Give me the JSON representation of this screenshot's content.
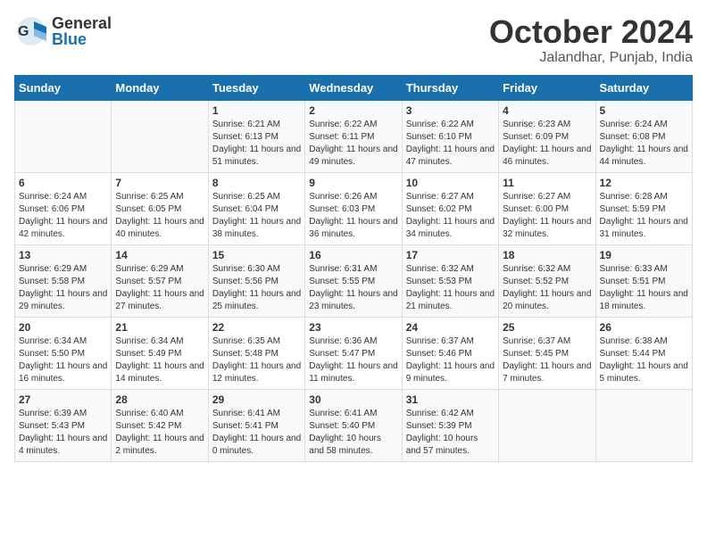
{
  "header": {
    "logo_line1": "General",
    "logo_line2": "Blue",
    "month_title": "October 2024",
    "location": "Jalandhar, Punjab, India"
  },
  "weekdays": [
    "Sunday",
    "Monday",
    "Tuesday",
    "Wednesday",
    "Thursday",
    "Friday",
    "Saturday"
  ],
  "weeks": [
    [
      null,
      null,
      {
        "day": 1,
        "sunrise": "6:21 AM",
        "sunset": "6:13 PM",
        "daylight": "11 hours and 51 minutes."
      },
      {
        "day": 2,
        "sunrise": "6:22 AM",
        "sunset": "6:11 PM",
        "daylight": "11 hours and 49 minutes."
      },
      {
        "day": 3,
        "sunrise": "6:22 AM",
        "sunset": "6:10 PM",
        "daylight": "11 hours and 47 minutes."
      },
      {
        "day": 4,
        "sunrise": "6:23 AM",
        "sunset": "6:09 PM",
        "daylight": "11 hours and 46 minutes."
      },
      {
        "day": 5,
        "sunrise": "6:24 AM",
        "sunset": "6:08 PM",
        "daylight": "11 hours and 44 minutes."
      }
    ],
    [
      {
        "day": 6,
        "sunrise": "6:24 AM",
        "sunset": "6:06 PM",
        "daylight": "11 hours and 42 minutes."
      },
      {
        "day": 7,
        "sunrise": "6:25 AM",
        "sunset": "6:05 PM",
        "daylight": "11 hours and 40 minutes."
      },
      {
        "day": 8,
        "sunrise": "6:25 AM",
        "sunset": "6:04 PM",
        "daylight": "11 hours and 38 minutes."
      },
      {
        "day": 9,
        "sunrise": "6:26 AM",
        "sunset": "6:03 PM",
        "daylight": "11 hours and 36 minutes."
      },
      {
        "day": 10,
        "sunrise": "6:27 AM",
        "sunset": "6:02 PM",
        "daylight": "11 hours and 34 minutes."
      },
      {
        "day": 11,
        "sunrise": "6:27 AM",
        "sunset": "6:00 PM",
        "daylight": "11 hours and 32 minutes."
      },
      {
        "day": 12,
        "sunrise": "6:28 AM",
        "sunset": "5:59 PM",
        "daylight": "11 hours and 31 minutes."
      }
    ],
    [
      {
        "day": 13,
        "sunrise": "6:29 AM",
        "sunset": "5:58 PM",
        "daylight": "11 hours and 29 minutes."
      },
      {
        "day": 14,
        "sunrise": "6:29 AM",
        "sunset": "5:57 PM",
        "daylight": "11 hours and 27 minutes."
      },
      {
        "day": 15,
        "sunrise": "6:30 AM",
        "sunset": "5:56 PM",
        "daylight": "11 hours and 25 minutes."
      },
      {
        "day": 16,
        "sunrise": "6:31 AM",
        "sunset": "5:55 PM",
        "daylight": "11 hours and 23 minutes."
      },
      {
        "day": 17,
        "sunrise": "6:32 AM",
        "sunset": "5:53 PM",
        "daylight": "11 hours and 21 minutes."
      },
      {
        "day": 18,
        "sunrise": "6:32 AM",
        "sunset": "5:52 PM",
        "daylight": "11 hours and 20 minutes."
      },
      {
        "day": 19,
        "sunrise": "6:33 AM",
        "sunset": "5:51 PM",
        "daylight": "11 hours and 18 minutes."
      }
    ],
    [
      {
        "day": 20,
        "sunrise": "6:34 AM",
        "sunset": "5:50 PM",
        "daylight": "11 hours and 16 minutes."
      },
      {
        "day": 21,
        "sunrise": "6:34 AM",
        "sunset": "5:49 PM",
        "daylight": "11 hours and 14 minutes."
      },
      {
        "day": 22,
        "sunrise": "6:35 AM",
        "sunset": "5:48 PM",
        "daylight": "11 hours and 12 minutes."
      },
      {
        "day": 23,
        "sunrise": "6:36 AM",
        "sunset": "5:47 PM",
        "daylight": "11 hours and 11 minutes."
      },
      {
        "day": 24,
        "sunrise": "6:37 AM",
        "sunset": "5:46 PM",
        "daylight": "11 hours and 9 minutes."
      },
      {
        "day": 25,
        "sunrise": "6:37 AM",
        "sunset": "5:45 PM",
        "daylight": "11 hours and 7 minutes."
      },
      {
        "day": 26,
        "sunrise": "6:38 AM",
        "sunset": "5:44 PM",
        "daylight": "11 hours and 5 minutes."
      }
    ],
    [
      {
        "day": 27,
        "sunrise": "6:39 AM",
        "sunset": "5:43 PM",
        "daylight": "11 hours and 4 minutes."
      },
      {
        "day": 28,
        "sunrise": "6:40 AM",
        "sunset": "5:42 PM",
        "daylight": "11 hours and 2 minutes."
      },
      {
        "day": 29,
        "sunrise": "6:41 AM",
        "sunset": "5:41 PM",
        "daylight": "11 hours and 0 minutes."
      },
      {
        "day": 30,
        "sunrise": "6:41 AM",
        "sunset": "5:40 PM",
        "daylight": "10 hours and 58 minutes."
      },
      {
        "day": 31,
        "sunrise": "6:42 AM",
        "sunset": "5:39 PM",
        "daylight": "10 hours and 57 minutes."
      },
      null,
      null
    ]
  ]
}
